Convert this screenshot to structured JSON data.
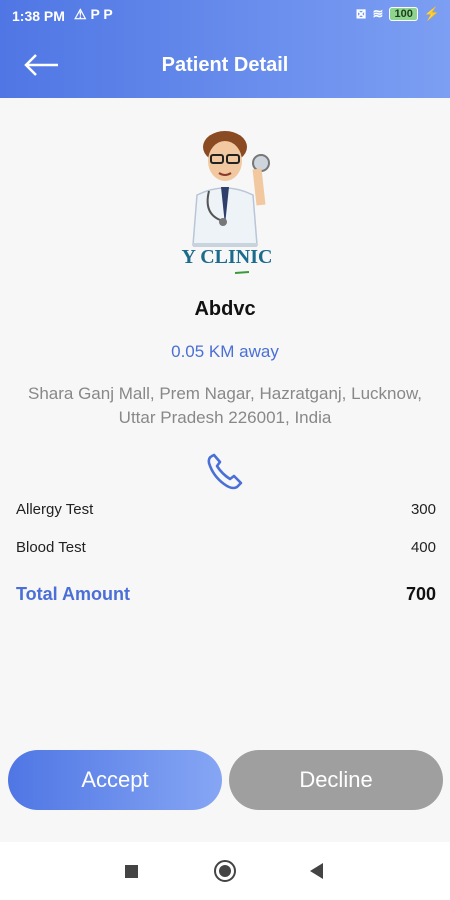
{
  "status_bar": {
    "time": "1:38 PM",
    "left_icons": "⚠ P P",
    "battery": "100"
  },
  "header": {
    "title": "Patient Detail"
  },
  "logo": {
    "text": "Y CLINIC"
  },
  "patient": {
    "name": "Abdvc",
    "distance": "0.05 KM away",
    "address_line1": "Shara Ganj Mall, Prem Nagar, Hazratganj, Lucknow,",
    "address_line2": "Uttar Pradesh 226001, India"
  },
  "tests": [
    {
      "name": "Allergy Test",
      "amount": "300"
    },
    {
      "name": "Blood Test",
      "amount": "400"
    }
  ],
  "total": {
    "label": "Total Amount",
    "value": "700"
  },
  "actions": {
    "accept": "Accept",
    "decline": "Decline"
  },
  "colors": {
    "accent": "#4a6fd6",
    "header_start": "#4f76e4",
    "header_end": "#7c9ff3",
    "decline": "#9f9f9f"
  }
}
